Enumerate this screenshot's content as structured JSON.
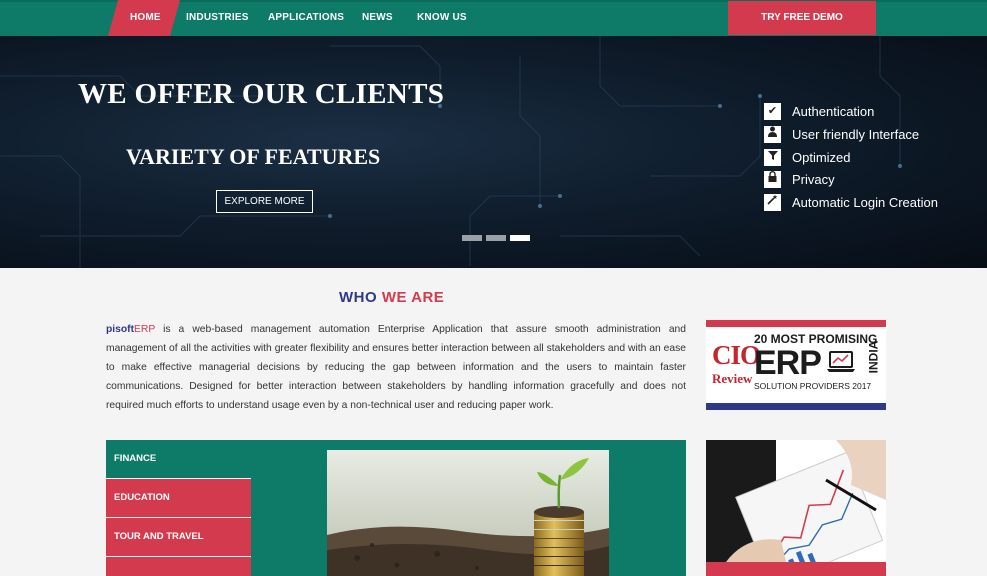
{
  "nav": {
    "home": "HOME",
    "industries": "INDUSTRIES",
    "applications": "APPLICATIONS",
    "news": "NEWS",
    "know_us": "KNOW US",
    "demo": "TRY FREE DEMO"
  },
  "hero": {
    "title_line1": "WE OFFER OUR CLIENTS",
    "title_line2": "VARIETY OF FEATURES",
    "button": "EXPLORE MORE",
    "slides": 3,
    "active_slide": 3,
    "features": [
      {
        "label": "Authentication",
        "icon": "check-icon"
      },
      {
        "label": "User friendly Interface",
        "icon": "user-icon"
      },
      {
        "label": "Optimized",
        "icon": "filter-icon"
      },
      {
        "label": "Privacy",
        "icon": "lock-icon"
      },
      {
        "label": "Automatic Login Creation",
        "icon": "magic-wand-icon"
      }
    ]
  },
  "who": {
    "title_part1": "WHO",
    "title_part2": "WE ARE",
    "brand_prefix": "pisoft",
    "brand_suffix": "ERP",
    "description": " is a web-based management automation Enterprise Application that assure smooth administration and management of all the activities with greater flexibility and ensures better interaction between all stakeholders and with an ease to make effective managerial decisions by reducing the gap between information and the users to maintain faster communications. Designed for better interaction between stakeholders by handling information gracefully and does not required much efforts to understand usage even by a non-technical user and reducing paper work."
  },
  "badge": {
    "logo": "CIO",
    "logo_sub": "Review",
    "line1": "20 MOST PROMISING",
    "line2": "ERP",
    "line3": "SOLUTION PROVIDERS 2017",
    "country": "INDIA"
  },
  "industries_menu": [
    "FINANCE",
    "EDUCATION",
    "TOUR AND TRAVEL"
  ],
  "colors": {
    "primary": "#0e7b69",
    "accent": "#d43a4d",
    "brand_blue": "#2e3a87"
  }
}
